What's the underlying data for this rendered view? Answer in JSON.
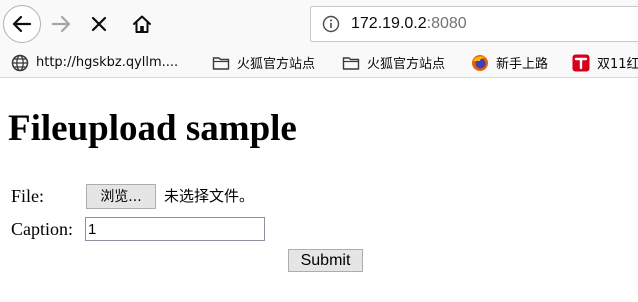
{
  "browser": {
    "url_host": "172.19.0.2",
    "url_port": ":8080",
    "bookmarks": [
      {
        "label": "http://hgskbz.qyllm....",
        "icon": "globe-icon"
      },
      {
        "label": "火狐官方站点",
        "icon": "folder-icon"
      },
      {
        "label": "火狐官方站点",
        "icon": "folder-icon"
      },
      {
        "label": "新手上路",
        "icon": "firefox-icon"
      },
      {
        "label": "双11红",
        "icon": "tmall-icon"
      }
    ]
  },
  "page": {
    "title": "Fileupload sample",
    "file_label": "File:",
    "browse_label": "浏览...",
    "no_file_text": "未选择文件。",
    "caption_label": "Caption:",
    "caption_value": "1",
    "submit_label": "Submit"
  }
}
